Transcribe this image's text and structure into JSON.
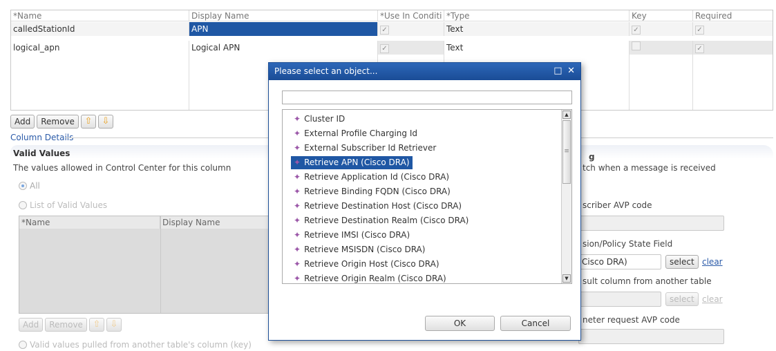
{
  "main_table": {
    "headers": [
      "*Name",
      "Display Name",
      "*Use In Conditi",
      "*Type",
      "Key",
      "Required"
    ],
    "rows": [
      {
        "name": "calledStationId",
        "display": "APN",
        "use": "✓",
        "type": "Text",
        "key": "✓",
        "required": "✓"
      },
      {
        "name": "logical_apn",
        "display": "Logical APN",
        "use": "✓",
        "type": "Text",
        "key": "",
        "required": "✓"
      }
    ]
  },
  "toolbar": {
    "add": "Add",
    "remove": "Remove",
    "up_icon": "arrow-up-icon",
    "down_icon": "arrow-down-icon"
  },
  "column_details": "Column Details",
  "valid_values": {
    "title": "Valid Values",
    "description": "The values allowed in Control Center for this column",
    "radio_all": "All",
    "radio_list": "List of Valid Values",
    "table_headers": [
      "*Name",
      "Display Name"
    ],
    "add": "Add",
    "remove": "Remove",
    "radio_pulled": "Valid values pulled from another table's column (key)"
  },
  "right_panel": {
    "heading_frag": "g",
    "desc_frag": "tch when a message is received",
    "avp_frag": "scriber AVP code",
    "state_frag": "sion/Policy State Field",
    "field_value": "Cisco DRA)",
    "select": "select",
    "clear": "clear",
    "result_frag": "sult column from another table",
    "select2": "select",
    "clear2": "clear",
    "request_frag": "neter request AVP code"
  },
  "modal": {
    "title": "Please select an object...",
    "controls": "□ ✕",
    "search_value": "",
    "items": [
      "Cluster ID",
      "External Profile Charging Id",
      "External Subscriber Id Retriever",
      "Retrieve APN (Cisco DRA)",
      "Retrieve Application Id (Cisco DRA)",
      "Retrieve Binding FQDN (Cisco DRA)",
      "Retrieve Destination Host (Cisco DRA)",
      "Retrieve Destination Realm (Cisco DRA)",
      "Retrieve IMSI (Cisco DRA)",
      "Retrieve MSISDN (Cisco DRA)",
      "Retrieve Origin Host (Cisco DRA)",
      "Retrieve Origin Realm (Cisco DRA)"
    ],
    "selected_index": 3,
    "ok": "OK",
    "cancel": "Cancel"
  },
  "colors": {
    "accent": "#1f57a4",
    "title_bar": "#2d67b8",
    "link": "#2a5aa8",
    "item_icon": "#9b57a8"
  }
}
